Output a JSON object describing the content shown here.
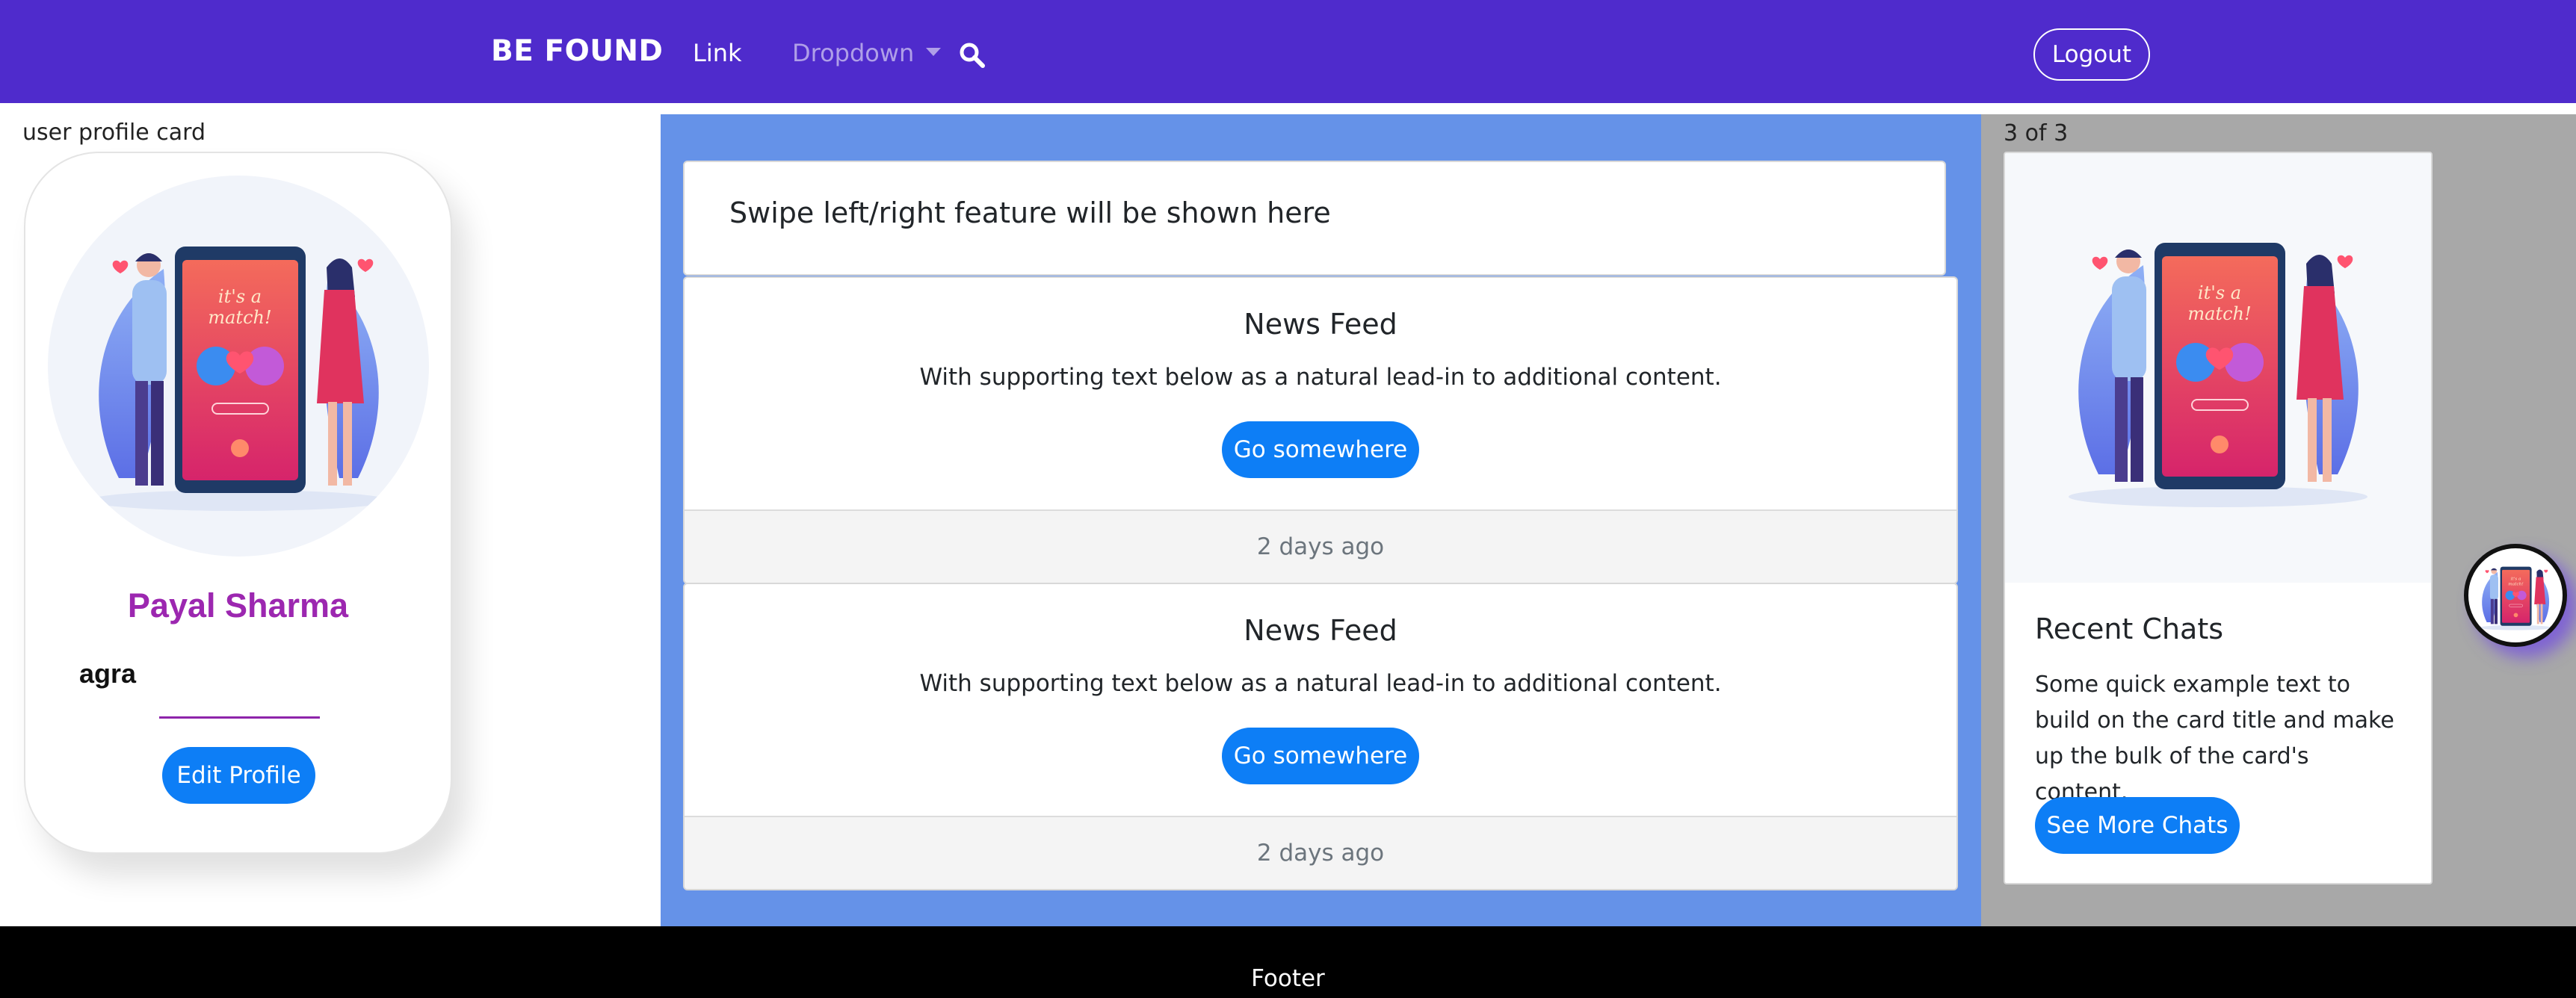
{
  "navbar": {
    "brand": "BE FOUND",
    "link": "Link",
    "dropdown": "Dropdown",
    "search_icon": "search-icon",
    "logout": "Logout",
    "background_color": "#4f2bcc"
  },
  "profile": {
    "section_label": "user profile card",
    "name": "Payal Sharma",
    "city": "agra",
    "edit_button": "Edit Profile",
    "illustration": "dating-app-match-illustration",
    "name_color": "#9c27b0"
  },
  "main": {
    "swipe_text": "Swipe left/right feature will be shown here",
    "feeds": [
      {
        "title": "News Feed",
        "text": "With supporting text below as a natural lead-in to additional content.",
        "button": "Go somewhere",
        "footer": "2 days ago"
      },
      {
        "title": "News Feed",
        "text": "With supporting text below as a natural lead-in to additional content.",
        "button": "Go somewhere",
        "footer": "2 days ago"
      }
    ],
    "background_color": "#6592e8"
  },
  "sidebar": {
    "carousel_count": "3 of 3",
    "card_title": "Recent Chats",
    "card_text": "Some quick example text to build on the card title and make up the bulk of the card's content.",
    "card_button": "See More Chats",
    "illustration": "dating-app-match-illustration"
  },
  "footer": {
    "text": "Footer"
  },
  "colors": {
    "primary_button": "#0d7ef6",
    "footer_bg": "#000000"
  }
}
